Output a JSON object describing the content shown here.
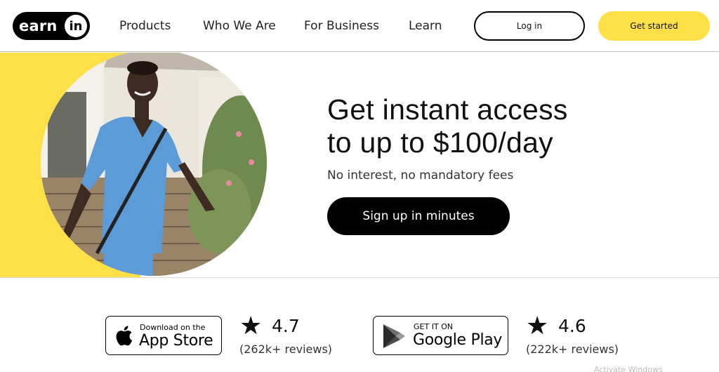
{
  "header": {
    "logo": {
      "word": "earn",
      "badge": "in"
    },
    "nav": [
      "Products",
      "Who We Are",
      "For Business",
      "Learn"
    ],
    "login_label": "Log in",
    "cta_label": "Get started"
  },
  "hero": {
    "title_line1": "Get instant access",
    "title_line2": "to up to $100/day",
    "subtitle": "No interest, no mandatory fees",
    "button_label": "Sign up in minutes"
  },
  "stores": {
    "apple": {
      "small": "Download on the",
      "big": "App Store",
      "rating": "4.7",
      "reviews": "(262k+ reviews)"
    },
    "google": {
      "small": "GET IT ON",
      "big": "Google Play",
      "rating": "4.6",
      "reviews": "(222k+ reviews)"
    }
  },
  "overlay": {
    "watermark": "Activate Windows"
  },
  "colors": {
    "accent_yellow": "#fde047",
    "black": "#000000",
    "scrub_blue": "#5b9bd8"
  },
  "icons": [
    "star-icon",
    "apple-logo-icon",
    "google-play-icon"
  ]
}
